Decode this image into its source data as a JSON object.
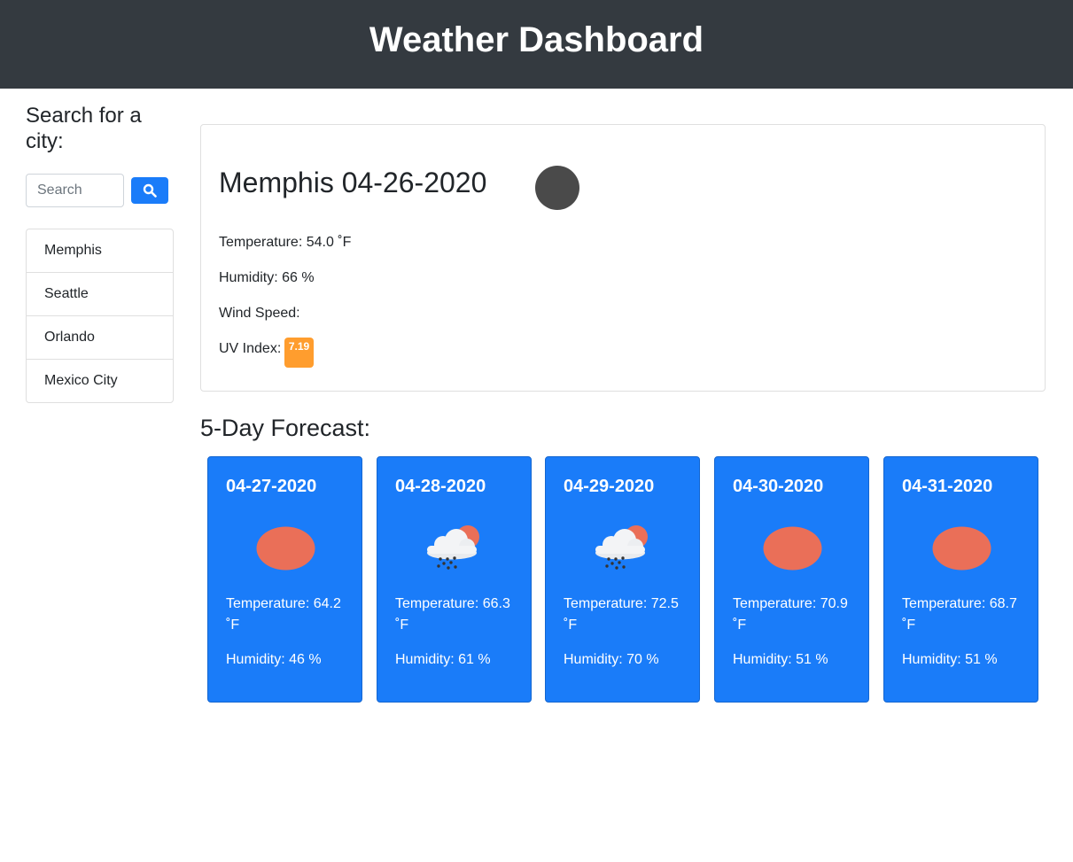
{
  "header": {
    "title": "Weather Dashboard"
  },
  "search": {
    "title": "Search for a city:",
    "placeholder": "Search",
    "button_icon": "search-icon"
  },
  "cities": [
    "Memphis",
    "Seattle",
    "Orlando",
    "Mexico City"
  ],
  "current": {
    "title": "Memphis 04-26-2020",
    "icon": "dark-circle-weather-icon",
    "temperature": "Temperature: 54.0 ˚F",
    "humidity": "Humidity: 66 %",
    "wind": "Wind Speed:",
    "uv_label": "UV Index:",
    "uv_value": "7.19",
    "uv_color": "#ff9d2e"
  },
  "forecast": {
    "title": "5-Day Forecast:",
    "days": [
      {
        "date": "04-27-2020",
        "icon": "sun-icon",
        "temp": "Temperature: 64.2 ˚F",
        "humidity": "Humidity: 46 %"
      },
      {
        "date": "04-28-2020",
        "icon": "rain-cloud-sun-icon",
        "temp": "Temperature: 66.3 ˚F",
        "humidity": "Humidity: 61 %"
      },
      {
        "date": "04-29-2020",
        "icon": "rain-cloud-sun-icon",
        "temp": "Temperature: 72.5 ˚F",
        "humidity": "Humidity: 70 %"
      },
      {
        "date": "04-30-2020",
        "icon": "sun-icon",
        "temp": "Temperature: 70.9 ˚F",
        "humidity": "Humidity: 51 %"
      },
      {
        "date": "04-31-2020",
        "icon": "sun-icon",
        "temp": "Temperature: 68.7 ˚F",
        "humidity": "Humidity: 51 %"
      }
    ]
  },
  "colors": {
    "header_bg": "#343a40",
    "primary": "#1a7cf9",
    "sun": "#ea6f58"
  }
}
